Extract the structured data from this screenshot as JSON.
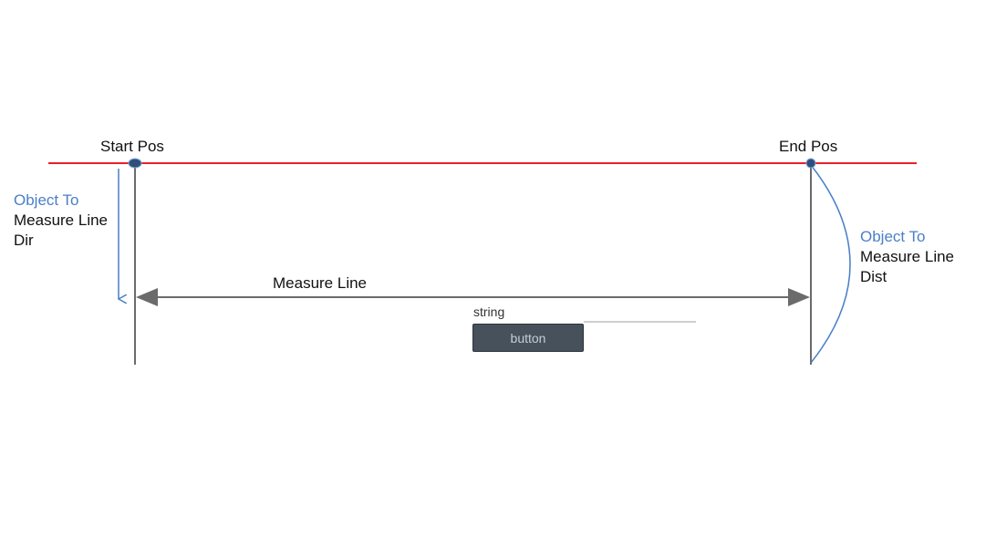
{
  "labels": {
    "start_pos": "Start Pos",
    "end_pos": "End Pos",
    "measure_line": "Measure Line",
    "object_to_dir_line1": "Object To",
    "object_to_dir_line2": "Measure Line",
    "object_to_dir_line3": "Dir",
    "object_to_dist_line1": "Object To",
    "object_to_dist_line2": "Measure Line",
    "object_to_dist_line3": "Dist"
  },
  "ui": {
    "string_label": "string",
    "button_label": "button"
  },
  "colors": {
    "reference_line": "#e8202a",
    "measure_line": "#6b6b6b",
    "point_marker": "#2f4f7a",
    "annotation_blue": "#4a7fc7",
    "button_bg": "#46515c"
  }
}
